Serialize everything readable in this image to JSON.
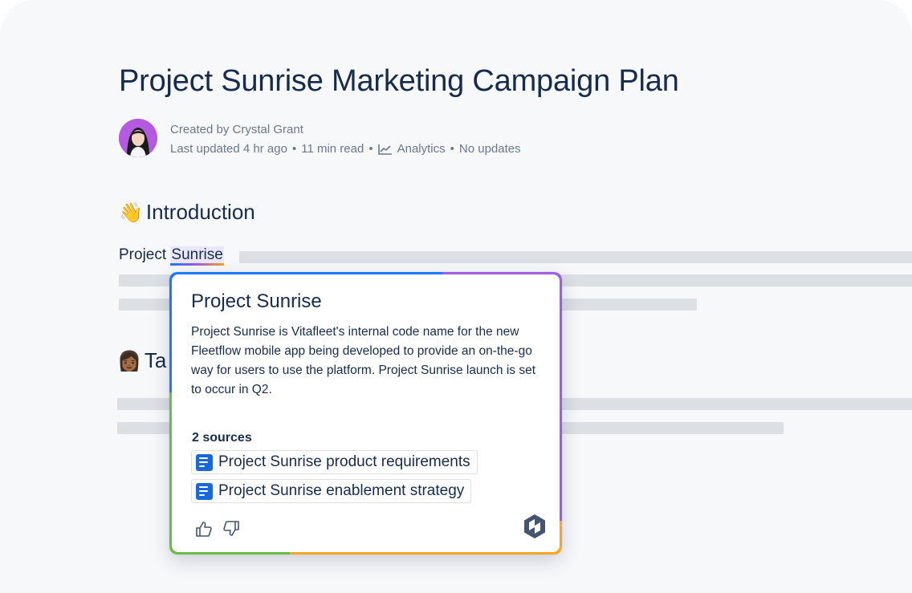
{
  "page": {
    "title": "Project Sunrise Marketing Campaign Plan",
    "meta": {
      "created_by": "Created by Crystal Grant",
      "last_updated": "Last updated 4 hr ago",
      "read_time": "11 min read",
      "analytics": "Analytics",
      "updates": "No updates",
      "separator": "•"
    },
    "sections": [
      {
        "emoji": "👋",
        "heading": "Introduction"
      },
      {
        "emoji": "👩🏾",
        "heading": "Ta"
      }
    ],
    "intro_text_prefix": "Project ",
    "intro_text_highlight": "Sunrise"
  },
  "popup": {
    "title": "Project Sunrise",
    "description": "Project Sunrise is Vitafleet's internal code name for the new Fleetflow mobile app being developed to provide an on-the-go way for users to use the platform. Project Sunrise launch is set to occur in Q2.",
    "sources_label": "2 sources",
    "sources": [
      {
        "label": "Project Sunrise product requirements"
      },
      {
        "label": "Project Sunrise enablement strategy"
      }
    ],
    "icons": [
      "thumbs-up-icon",
      "thumbs-down-icon",
      "atlassian-intelligence-logo-icon"
    ]
  },
  "colors": {
    "text": "#172b4d",
    "muted": "#6b778c",
    "placeholder_bar": "#dcdfe4",
    "doc_icon": "#1868db",
    "border_blue": "#1d7afc",
    "border_purple": "#a05ee0",
    "border_green": "#6bbd45",
    "border_yellow": "#f5a623"
  }
}
